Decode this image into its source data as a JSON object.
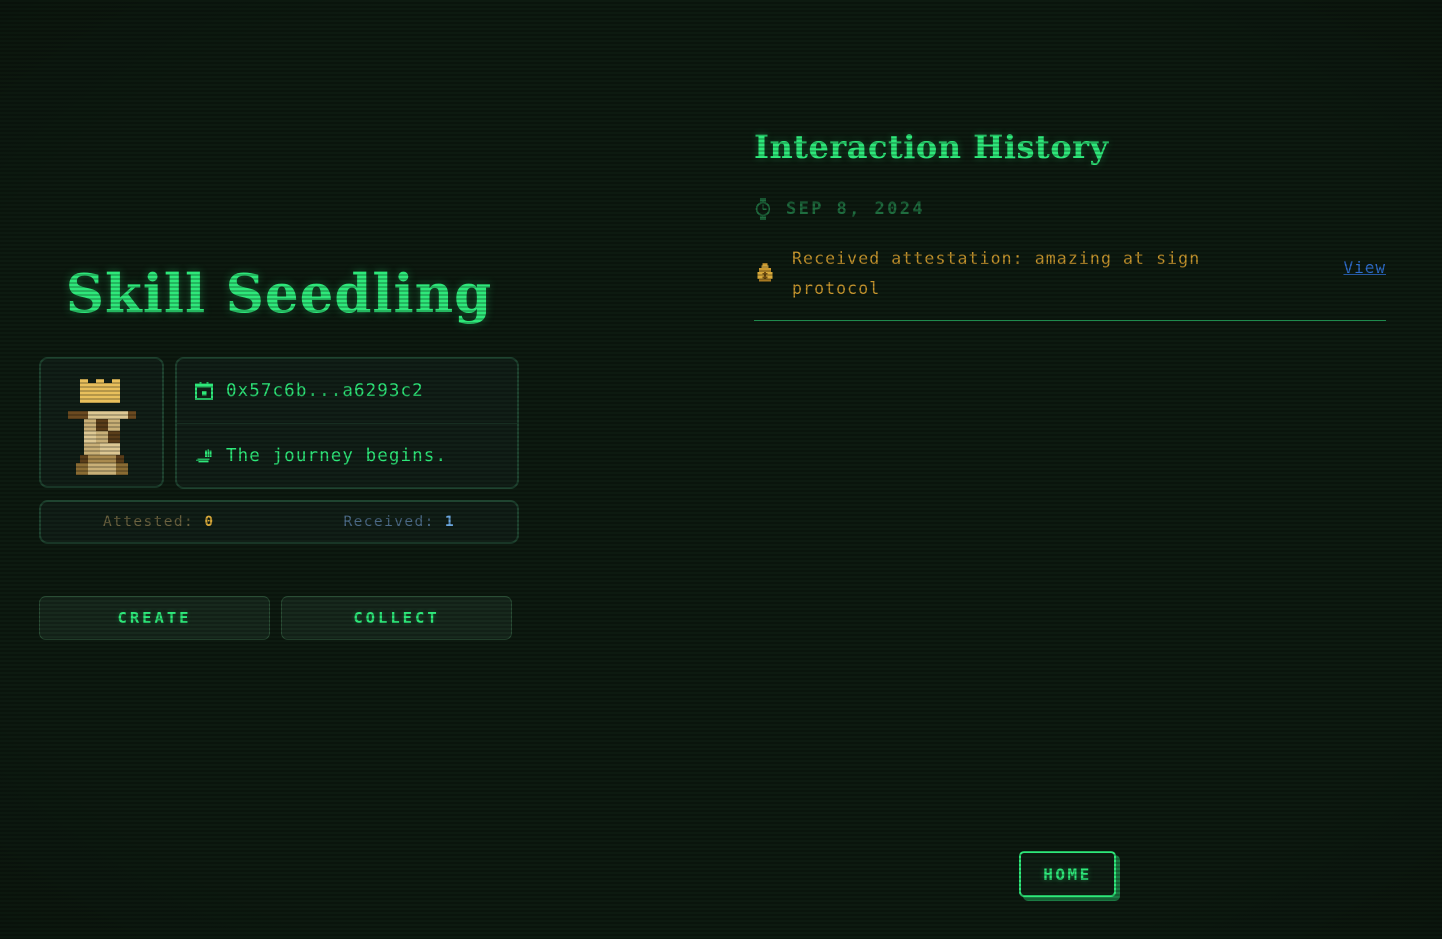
{
  "theme": {
    "background": "#0d1a10",
    "accent_green": "#2ee87a",
    "dim_green": "#1f6d3f",
    "gold": "#c8972e",
    "amber": "#d8a93a",
    "link_blue": "#2f6fd0",
    "stat_blue": "#6aa6dd"
  },
  "profile": {
    "title": "Skill Seedling",
    "avatar_icon": "pixel-rook-crown-sprite",
    "address_icon": "calendar-icon",
    "address": "0x57c6b...a6293c2",
    "tagline_icon": "seedling-icon",
    "tagline": "The journey begins.",
    "stats": [
      {
        "label": "Attested:",
        "value": "0",
        "name": "attested"
      },
      {
        "label": "Received:",
        "value": "1",
        "name": "received"
      }
    ],
    "actions": [
      {
        "label": "CREATE",
        "name": "create"
      },
      {
        "label": "COLLECT",
        "name": "collect"
      }
    ]
  },
  "history": {
    "title": "Interaction History",
    "date_icon": "watch-icon",
    "date": "SEP 8, 2024",
    "entries": [
      {
        "icon": "money-bag-icon",
        "text": "Received attestation: amazing at sign protocol",
        "link_label": "View"
      }
    ]
  },
  "footer": {
    "home_label": "HOME"
  }
}
